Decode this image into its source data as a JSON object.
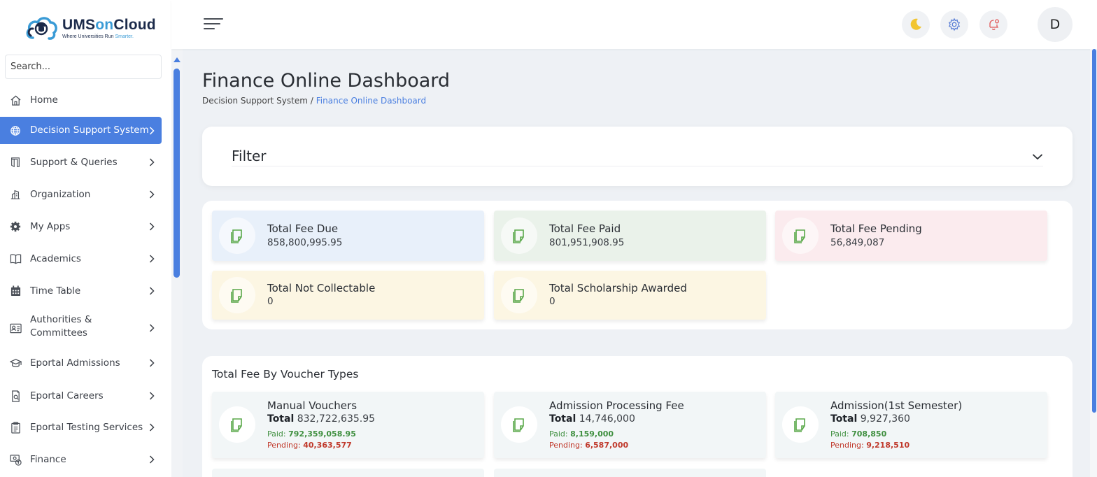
{
  "brand": {
    "name_part1": "UMS",
    "name_part2": "on",
    "name_part3": "Cloud",
    "tagline_part1": "Where Universities Run ",
    "tagline_part2": "Smarter."
  },
  "search": {
    "placeholder": "Search..."
  },
  "sidebar": {
    "items": [
      {
        "label": "Home",
        "icon": "home-icon",
        "active": false,
        "has_children": false
      },
      {
        "label": "Decision Support System",
        "icon": "globe-icon",
        "active": true,
        "has_children": true
      },
      {
        "label": "Support & Queries",
        "icon": "door-icon",
        "active": false,
        "has_children": true
      },
      {
        "label": "Organization",
        "icon": "building-icon",
        "active": false,
        "has_children": true
      },
      {
        "label": "My Apps",
        "icon": "gear-icon",
        "active": false,
        "has_children": true
      },
      {
        "label": "Academics",
        "icon": "book-icon",
        "active": false,
        "has_children": true
      },
      {
        "label": "Time Table",
        "icon": "calendar-icon",
        "active": false,
        "has_children": true
      },
      {
        "label": "Authorities &",
        "label_line2": "Committees",
        "icon": "id-card-icon",
        "active": false,
        "has_children": true
      },
      {
        "label": "Eportal Admissions",
        "icon": "graduation-cap-icon",
        "active": false,
        "has_children": true
      },
      {
        "label": "Eportal Careers",
        "icon": "document-search-icon",
        "active": false,
        "has_children": true
      },
      {
        "label": "Eportal Testing Services",
        "icon": "clipboard-icon",
        "active": false,
        "has_children": true
      },
      {
        "label": "Finance",
        "icon": "money-icon",
        "active": false,
        "has_children": true
      }
    ]
  },
  "header": {
    "avatar_initial": "D",
    "icons": [
      "moon-icon",
      "gear-icon",
      "bell-icon"
    ]
  },
  "page": {
    "title": "Finance Online Dashboard",
    "breadcrumb_parent": "Decision Support System /",
    "breadcrumb_current": "Finance Online Dashboard"
  },
  "filter": {
    "title": "Filter"
  },
  "kpis": [
    {
      "title": "Total Fee Due",
      "value": "858,800,995.95",
      "bg": "#e8f0fa"
    },
    {
      "title": "Total Fee Paid",
      "value": "801,951,908.95",
      "bg": "#eaf2ea"
    },
    {
      "title": "Total Fee Pending",
      "value": "56,849,087",
      "bg": "#fbebee"
    },
    {
      "title": "Total Not Collectable",
      "value": "0",
      "bg": "#fcf6e3"
    },
    {
      "title": "Total Scholarship Awarded",
      "value": "0",
      "bg": "#fcf6e3"
    }
  ],
  "vouchers": {
    "title": "Total Fee By Voucher Types",
    "total_label": "Total",
    "paid_label": "Paid:",
    "pending_label": "Pending:",
    "items": [
      {
        "title": "Manual Vouchers",
        "total": "832,722,635.95",
        "paid": "792,359,058.95",
        "pending": "40,363,577"
      },
      {
        "title": "Admission Processing Fee",
        "total": "14,746,000",
        "paid": "8,159,000",
        "pending": "6,587,000"
      },
      {
        "title": "Admission(1st Semester)",
        "total": "9,927,360",
        "paid": "708,850",
        "pending": "9,218,510"
      }
    ]
  },
  "colors": {
    "accent": "#4a7fe0",
    "icon_green": "#5aa84a",
    "paid_green": "#3f8f3f",
    "pending_red": "#c0392b"
  }
}
